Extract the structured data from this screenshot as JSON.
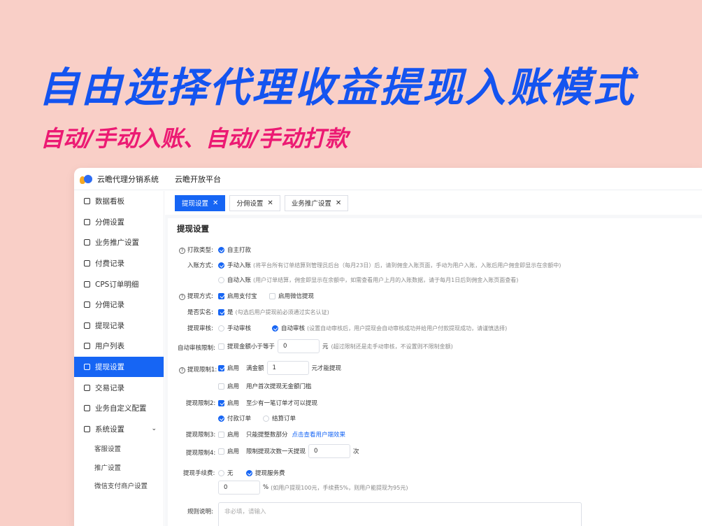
{
  "banner": {
    "headline": "自由选择代理收益提现入账模式",
    "subline": "自动/手动入账、自动/手动打款"
  },
  "app": {
    "name": "云瞻代理分销系统",
    "platform": "云瞻开放平台"
  },
  "sidebar": {
    "items": [
      {
        "label": "数据看板"
      },
      {
        "label": "分佣设置"
      },
      {
        "label": "业务推广设置"
      },
      {
        "label": "付费记录"
      },
      {
        "label": "CPS订单明细"
      },
      {
        "label": "分佣记录"
      },
      {
        "label": "提现记录"
      },
      {
        "label": "用户列表"
      },
      {
        "label": "提现设置",
        "active": true
      },
      {
        "label": "交易记录"
      },
      {
        "label": "业务自定义配置"
      },
      {
        "label": "系统设置"
      }
    ],
    "sub_items": [
      {
        "label": "客服设置"
      },
      {
        "label": "推广设置"
      },
      {
        "label": "微信支付商户设置"
      }
    ]
  },
  "tabs": [
    {
      "label": "提现设置",
      "active": true
    },
    {
      "label": "分佣设置"
    },
    {
      "label": "业务推广设置"
    }
  ],
  "form": {
    "title": "提现设置",
    "pay_type": {
      "label": "打款类型:",
      "option": "自主打款"
    },
    "entry_mode": {
      "label": "入账方式:",
      "manual": "手动入账",
      "manual_hint": "(将平台所有订单结算到管理员后台（每月23日）后，请到佣金入账页面，手动为用户入账，入账后用户佣金即显示在余额中)",
      "auto": "自动入账",
      "auto_hint": "(用户订单结算，佣金即显示在余额中，如需查看用户上月的入账数据，请于每月1日后到佣金入账页面查看)"
    },
    "withdraw_method": {
      "label": "提现方式:",
      "alipay": "启用支付宝",
      "wechat": "启用微信提现"
    },
    "realname": {
      "label": "是否实名:",
      "option": "是",
      "hint": "(勾选后用户提现前必须通过实名认证)"
    },
    "audit": {
      "label": "提现审核:",
      "manual": "手动审核",
      "auto": "自动审核",
      "auto_hint": "(设置自动审核后，用户提现会自动审核成功并给用户付款提现成功，请谨慎选择)"
    },
    "auto_limit": {
      "label": "自动审核限制:",
      "option": "提现金额小于等于",
      "value": "0",
      "unit": "元",
      "hint": "(超过限制还是走手动审核，不设置则不限制金额)"
    },
    "limit1": {
      "label": "提现限制1:",
      "enable": "启用",
      "text": "满金额",
      "value": "1",
      "suffix": "元才能提现",
      "enable2": "启用",
      "text2": "用户首次提现无金额门槛"
    },
    "limit2": {
      "label": "提现限制2:",
      "enable": "启用",
      "text": "至少有一笔订单才可以提现",
      "paid": "付款订单",
      "settled": "结算订单"
    },
    "limit3": {
      "label": "提现限制3:",
      "enable": "启用",
      "text": "只能提整数部分",
      "link": "点击查看用户端效果"
    },
    "limit4": {
      "label": "提现限制4:",
      "enable": "启用",
      "text": "限制提现次数一天提现",
      "value": "0",
      "unit": "次"
    },
    "fee": {
      "label": "提现手续费:",
      "none": "无",
      "service": "提现服务费",
      "value": "0",
      "unit": "%",
      "hint": "(如用户提现100元，手续费5%，则用户能提现为95元)"
    },
    "rules": {
      "label": "规则说明:",
      "placeholder": "非必填，请输入"
    }
  }
}
